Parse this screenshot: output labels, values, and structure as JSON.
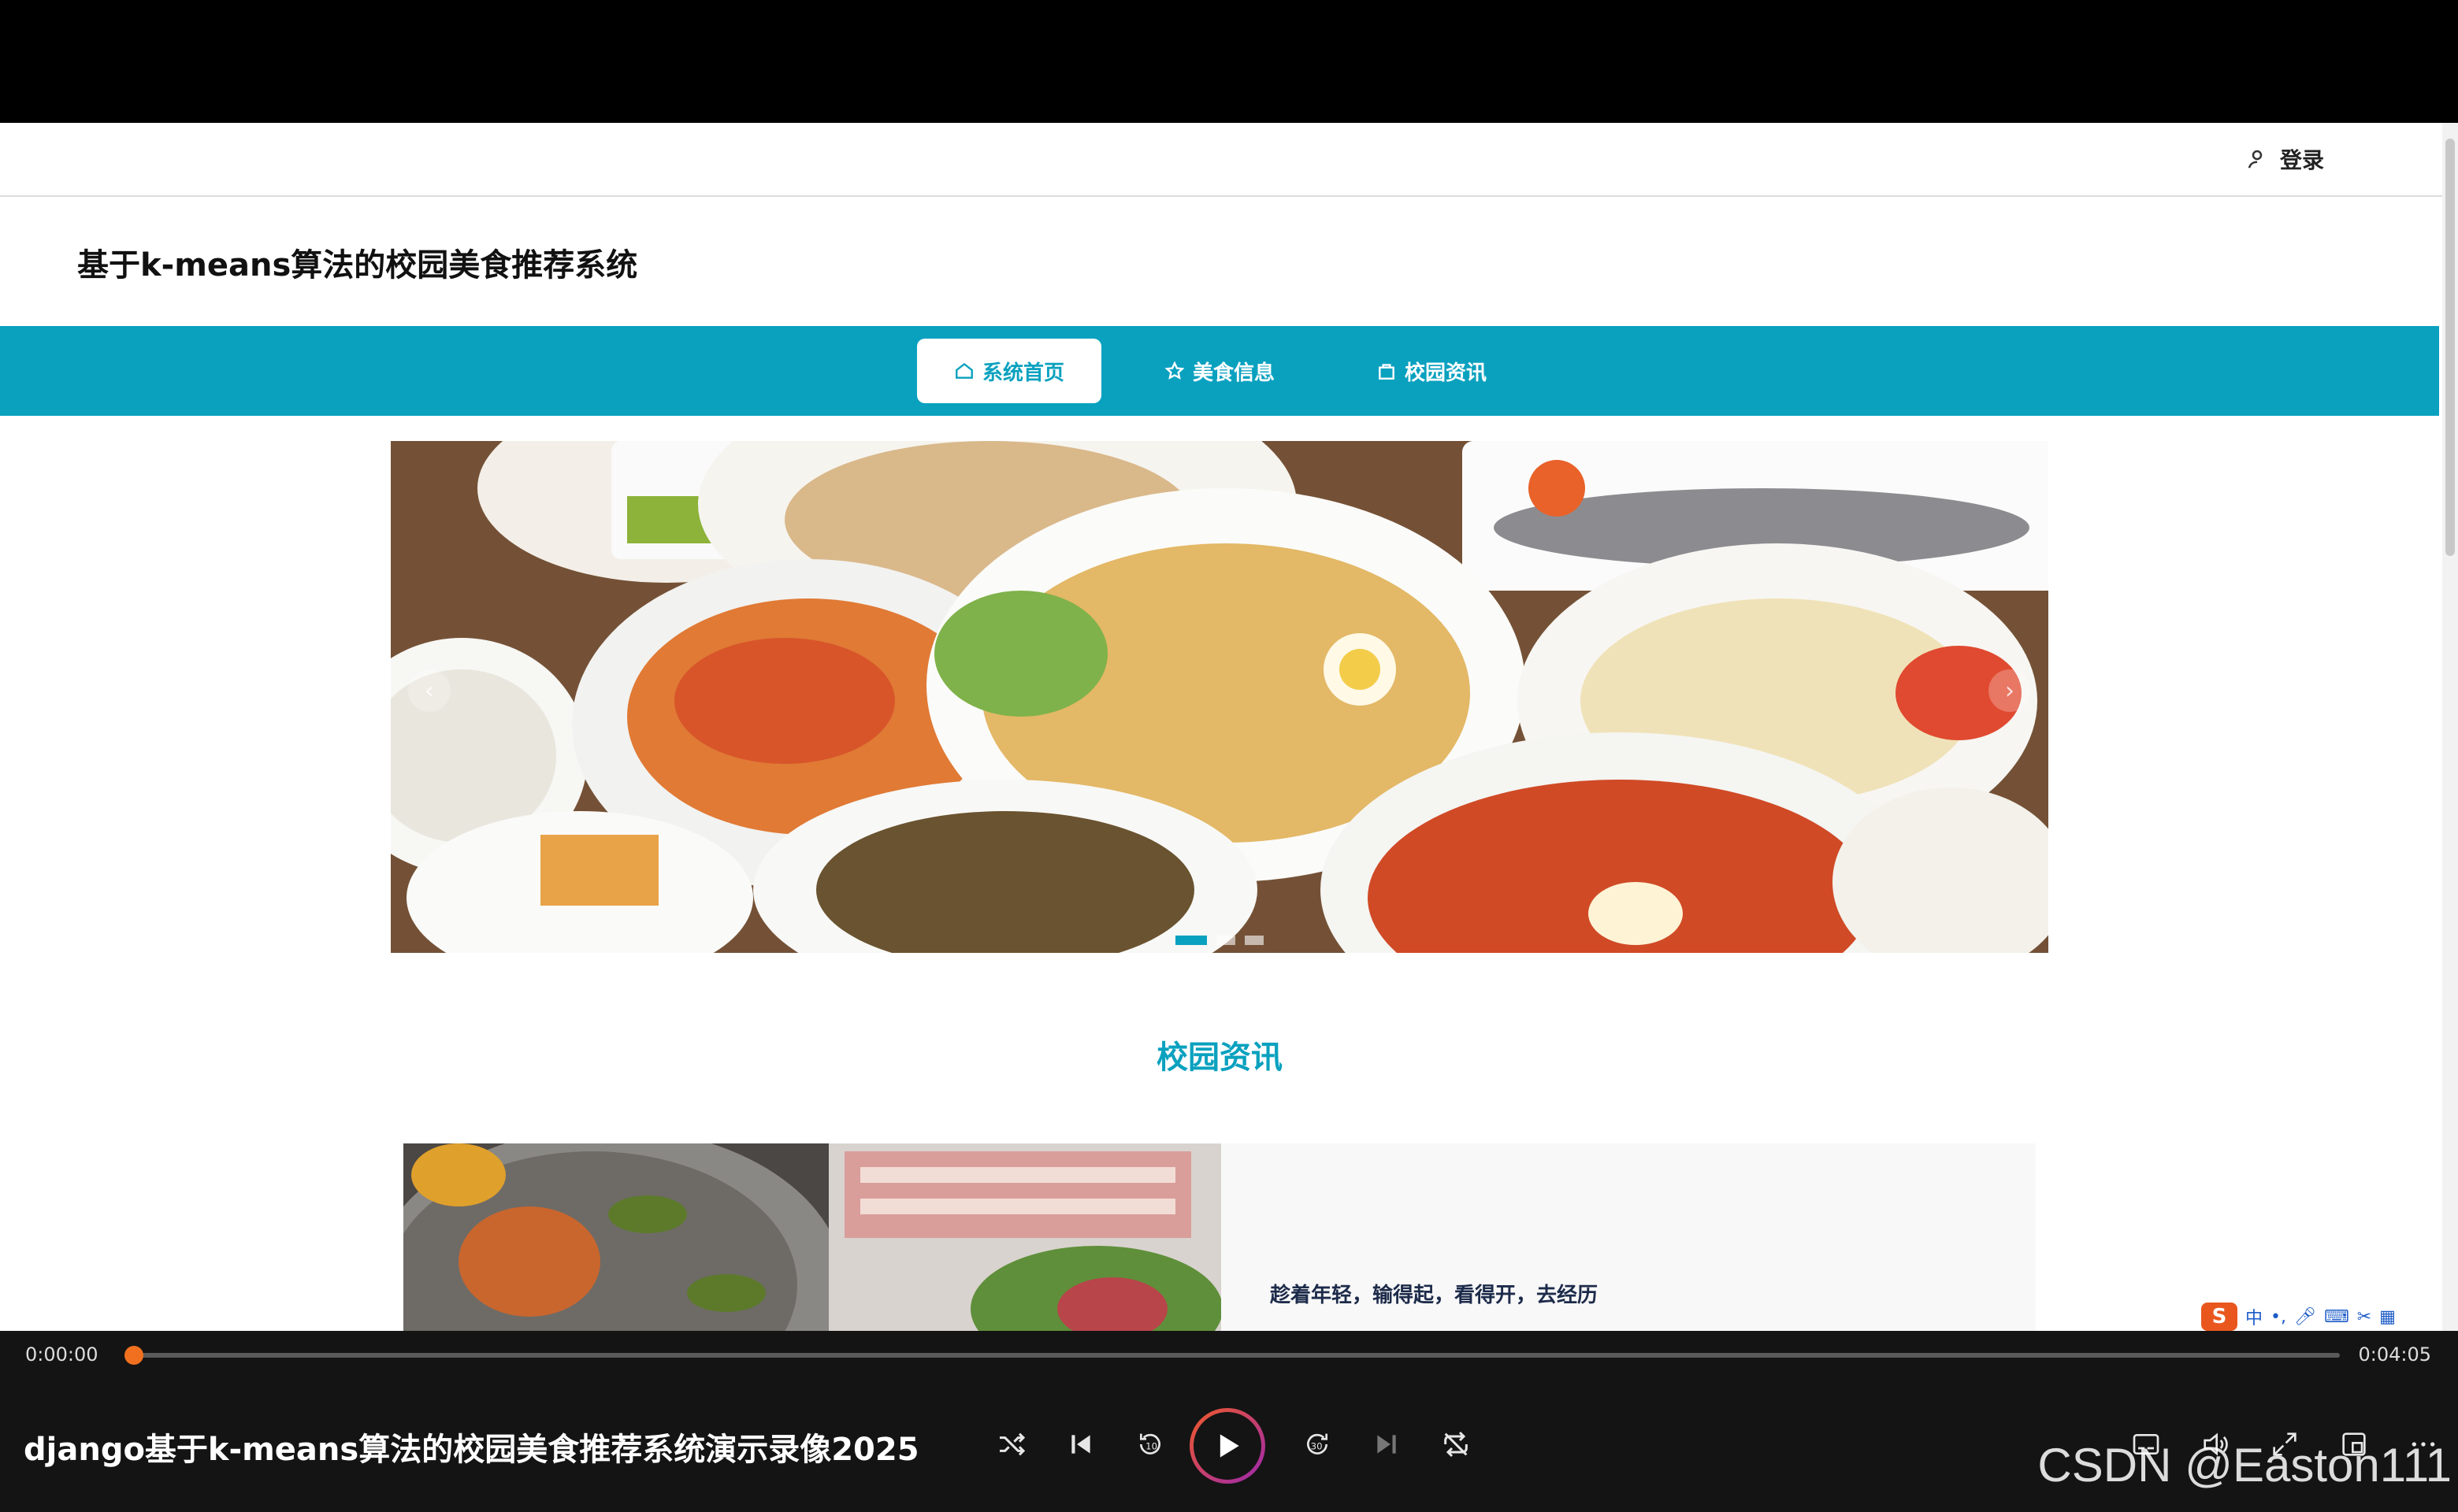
{
  "header": {
    "login_label": "登录"
  },
  "site": {
    "title": "基于k-means算法的校园美食推荐系统"
  },
  "nav": {
    "items": [
      {
        "label": "系统首页",
        "icon": "home-icon",
        "active": true
      },
      {
        "label": "美食信息",
        "icon": "star-icon",
        "active": false
      },
      {
        "label": "校园资讯",
        "icon": "bag-icon",
        "active": false
      }
    ]
  },
  "carousel": {
    "slides": 3,
    "active_index": 0
  },
  "news": {
    "section_title": "校园资讯",
    "items": [
      {
        "title": "趁着年轻，输得起，看得开，去经历"
      }
    ]
  },
  "ime": {
    "label": "中"
  },
  "player": {
    "current_time": "0:00:00",
    "total_time": "0:04:05",
    "progress": 0,
    "title": "django基于k-means算法的校园美食推荐系统演示录像2025",
    "skip_back_label": "10",
    "skip_forward_label": "30"
  },
  "watermark": "CSDN @Easton111",
  "colors": {
    "accent": "#0aa1bf",
    "progress": "#f07020",
    "player_bg": "#141414"
  }
}
